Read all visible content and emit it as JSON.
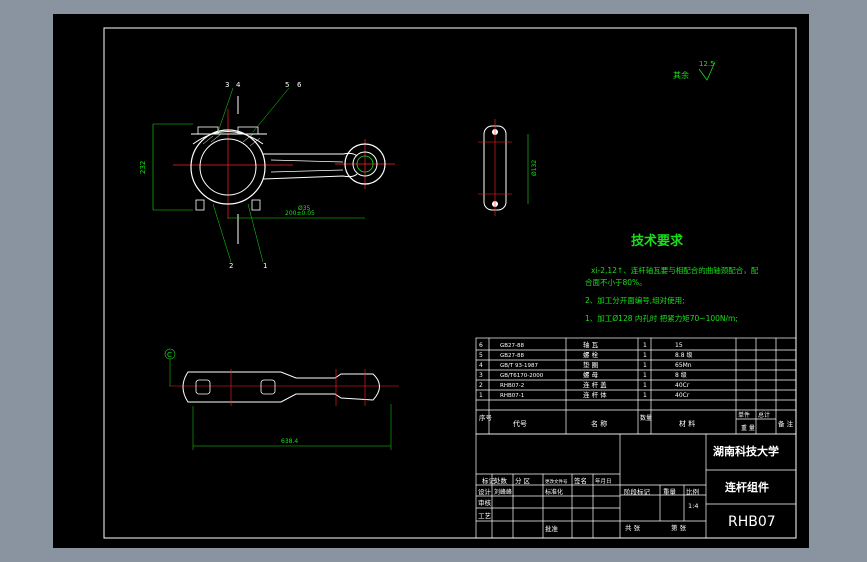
{
  "colors": {
    "background": "#8a94a0",
    "paper": "#000000",
    "geometry": "#ffffff",
    "dimension": "#18e018",
    "centerline": "#ff2020",
    "hidden": "#5aa0ff",
    "requirements_title": "#18e018",
    "requirements_text": "#18e018"
  },
  "drawing": {
    "parts_labels": [
      "3",
      "4",
      "5",
      "6",
      "2",
      "1"
    ],
    "surface_finish": {
      "label": "其余",
      "value": "12.5"
    },
    "dimensions": {
      "height": "232",
      "small_end": "Ø35",
      "center_distance": "200±0.05",
      "big_end_side": "Ø132",
      "bottom_length": "638.4",
      "datum": "C"
    }
  },
  "requirements": {
    "title": "技术要求",
    "lines": [
      "xi-2,12↑、连杆轴瓦要与相配合的曲轴颈配合，配",
      "合面不小于80%。",
      "2、加工分开面编号,组对使用;",
      "1、加工Ø128 内孔时 把紧力矩70~100N/m;"
    ]
  },
  "bom": {
    "rows": [
      {
        "no": "6",
        "code": "GB27-88",
        "name": "轴 瓦",
        "qty": "1",
        "material": "15",
        "weight": "",
        "total": "",
        "note": ""
      },
      {
        "no": "5",
        "code": "GB27-88",
        "name": "螺 栓",
        "qty": "1",
        "material": "8.8 级",
        "weight": "",
        "total": "",
        "note": ""
      },
      {
        "no": "4",
        "code": "GB/T 93-1987",
        "name": "垫 圈",
        "qty": "1",
        "material": "65Mn",
        "weight": "",
        "total": "",
        "note": ""
      },
      {
        "no": "3",
        "code": "GB/T6170-2000",
        "name": "螺 母",
        "qty": "1",
        "material": "8 级",
        "weight": "",
        "total": "",
        "note": ""
      },
      {
        "no": "2",
        "code": "RHB07-2",
        "name": "连 杆 盖",
        "qty": "1",
        "material": "40Cr",
        "weight": "",
        "total": "",
        "note": ""
      },
      {
        "no": "1",
        "code": "RHB07-1",
        "name": "连 杆 体",
        "qty": "1",
        "material": "40Cr",
        "weight": "",
        "total": "",
        "note": ""
      }
    ],
    "header": {
      "no": "序号",
      "code": "代号",
      "name": "名 称",
      "qty": "数量",
      "material": "材 料",
      "unit": "单件",
      "total": "总计",
      "weight": "重 量",
      "note": "备 注"
    }
  },
  "title_block": {
    "school": "湖南科技大学",
    "part_name": "连杆组件",
    "drawing_no": "RHB07",
    "labels": {
      "mark": "标记",
      "count": "处数",
      "zone": "分 区",
      "doc": "更改文件号",
      "sign": "签名",
      "date": "年月日",
      "design": "设计",
      "designer": "刘峰峰",
      "standard": "标准化",
      "check": "审核",
      "process": "工艺",
      "approve": "批准",
      "stage": "阶段标记",
      "weight": "重量",
      "scale": "比例",
      "scale_val": "1:4",
      "total": "共 张",
      "sheet": "第 张"
    }
  }
}
